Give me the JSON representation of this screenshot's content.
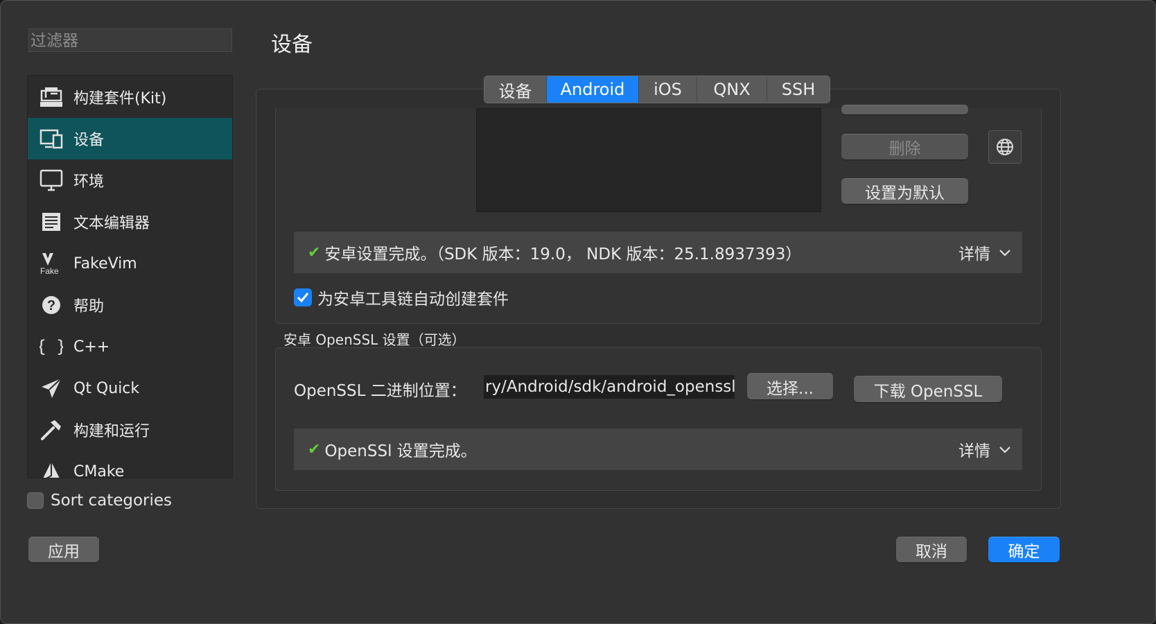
{
  "filter": {
    "placeholder": "过滤器"
  },
  "categories": [
    {
      "label": "构建套件(Kit)",
      "icon": "kit-icon"
    },
    {
      "label": "设备",
      "icon": "device-icon"
    },
    {
      "label": "环境",
      "icon": "monitor-icon"
    },
    {
      "label": "文本编辑器",
      "icon": "text-editor-icon"
    },
    {
      "label": "FakeVim",
      "icon": "fakevim-icon"
    },
    {
      "label": "帮助",
      "icon": "help-icon"
    },
    {
      "label": "C++",
      "icon": "braces-icon"
    },
    {
      "label": "Qt Quick",
      "icon": "qtquick-icon"
    },
    {
      "label": "构建和运行",
      "icon": "hammer-icon"
    },
    {
      "label": "CMake",
      "icon": "cmake-icon"
    }
  ],
  "selected_category": "设备",
  "sort_categories": {
    "label": "Sort categories",
    "checked": false
  },
  "page_title": "设备",
  "tabs": [
    {
      "label": "设备",
      "active": false
    },
    {
      "label": "Android",
      "active": true
    },
    {
      "label": "iOS",
      "active": false
    },
    {
      "label": "QNX",
      "active": false
    },
    {
      "label": "SSH",
      "active": false
    }
  ],
  "sdk_buttons": {
    "remove": "删除",
    "set_default": "设置为默认"
  },
  "android_status": {
    "message": "安卓设置完成。（SDK 版本：19.0， NDK 版本：25.1.8937393）",
    "details": "详情"
  },
  "auto_kit": {
    "label": "为安卓工具链自动创建套件",
    "checked": true
  },
  "openssl": {
    "group_title": "安卓 OpenSSL 设置（可选）",
    "path_label": "OpenSSL 二进制位置：",
    "path_value": "ry/Android/sdk/android_openssl",
    "choose": "选择...",
    "download": "下载 OpenSSL",
    "status": "OpenSSl 设置完成。",
    "details": "详情"
  },
  "footer": {
    "apply": "应用",
    "cancel": "取消",
    "ok": "确定"
  },
  "colors": {
    "accent": "#1a82f6",
    "selection": "#0e545a",
    "check_green": "#5fcf3a"
  }
}
